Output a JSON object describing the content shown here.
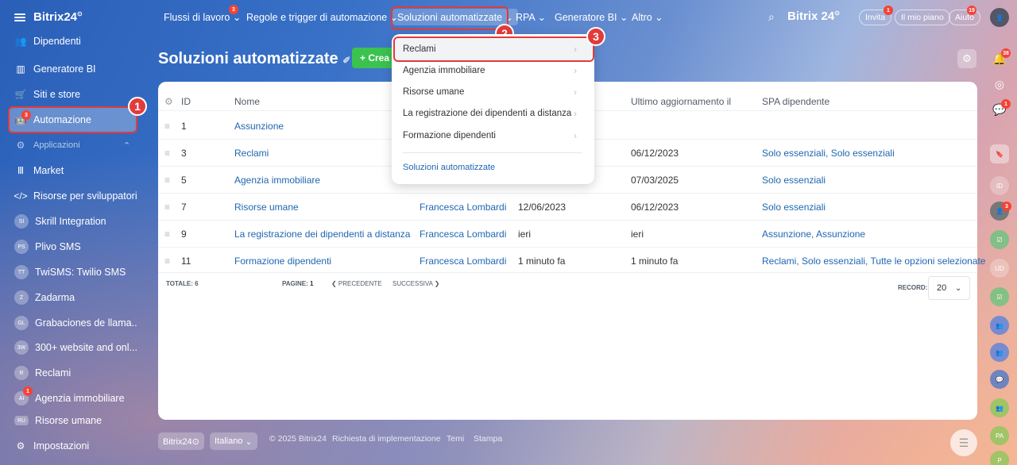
{
  "app": {
    "logo": "Bitrix24",
    "logo_mark": "⊙"
  },
  "sidebar": {
    "items": [
      {
        "label": "Dipendenti",
        "icon": "people-icon"
      },
      {
        "label": "Generatore BI",
        "icon": "chart-icon"
      },
      {
        "label": "Siti e store",
        "icon": "cart-icon"
      },
      {
        "label": "Automazione",
        "icon": "robot-icon",
        "badge": "3"
      },
      {
        "label": "Applicazioni",
        "icon": "apps-icon"
      },
      {
        "label": "Market",
        "icon": "market-icon"
      },
      {
        "label": "Risorse per sviluppatori",
        "icon": "code-icon"
      },
      {
        "label": "Skrill Integration",
        "abbr": "SI"
      },
      {
        "label": "Plivo SMS",
        "abbr": "PS"
      },
      {
        "label": "TwiSMS: Twilio SMS",
        "abbr": "TT"
      },
      {
        "label": "Zadarma",
        "abbr": "Z"
      },
      {
        "label": "Grabaciones de llama...",
        "abbr": "GL"
      },
      {
        "label": "300+ website and onl...",
        "abbr": "3W"
      },
      {
        "label": "Reclami",
        "abbr": "R"
      },
      {
        "label": "Agenzia immobiliare",
        "abbr": "AI",
        "badge": "1"
      },
      {
        "label": "Risorse umane",
        "abbr": "RU"
      }
    ],
    "settings": "Impostazioni"
  },
  "topnav": {
    "items": [
      {
        "label": "Flussi di lavoro",
        "badge": "3"
      },
      {
        "label": "Regole e trigger di automazione"
      },
      {
        "label": "Soluzioni automatizzate"
      },
      {
        "label": "RPA"
      },
      {
        "label": "Generatore BI"
      },
      {
        "label": "Altro"
      }
    ],
    "brand": "Bitrix 24",
    "brand_mark": "⊙",
    "invite": "Invita",
    "invite_badge": "1",
    "plan": "Il mio piano",
    "help": "Aiuto",
    "help_badge": "19"
  },
  "page": {
    "title": "Soluzioni automatizzate",
    "create_label": "+ Crea"
  },
  "table": {
    "headers": [
      "ID",
      "Nome",
      "Ultimo aggiornamento il",
      "SPA dipendente"
    ],
    "rows": [
      {
        "id": "1",
        "name": "Assunzione",
        "author": "",
        "created": "",
        "updated": "",
        "spa": ""
      },
      {
        "id": "3",
        "name": "Reclami",
        "author": "",
        "created": "",
        "updated": "06/12/2023",
        "spa": "Solo essenziali, Solo essenziali"
      },
      {
        "id": "5",
        "name": "Agenzia immobiliare",
        "author": "",
        "created": "",
        "updated": "07/03/2025",
        "spa": "Solo essenziali"
      },
      {
        "id": "7",
        "name": "Risorse umane",
        "author": "Francesca Lombardi",
        "created": "12/06/2023",
        "updated": "06/12/2023",
        "spa": "Solo essenziali"
      },
      {
        "id": "9",
        "name": "La registrazione dei dipendenti a distanza",
        "author": "Francesca Lombardi",
        "created": "ieri",
        "updated": "ieri",
        "spa": "Assunzione, Assunzione"
      },
      {
        "id": "11",
        "name": "Formazione dipendenti",
        "author": "Francesca Lombardi",
        "created": "1 minuto fa",
        "updated": "1 minuto fa",
        "spa": "Reclami, Solo essenziali, Tutte le opzioni selezionate"
      }
    ],
    "total": "TOTALE: 6",
    "pages_label": "PAGINE:",
    "page_num": "1",
    "prev": "❮ PRECEDENTE",
    "next": "SUCCESSIVA ❯",
    "record_label": "RECORD:",
    "record_value": "20"
  },
  "dropdown": {
    "items": [
      "Reclami",
      "Agenzia immobiliare",
      "Risorse umane",
      "La registrazione dei dipendenti a distanza",
      "Formazione dipendenti"
    ],
    "footer_link": "Soluzioni automatizzate"
  },
  "steps": [
    "1",
    "2",
    "3"
  ],
  "footer": {
    "brand": "Bitrix24⊙",
    "language": "Italiano",
    "copyright": "© 2025 Bitrix24",
    "links": [
      "Richiesta di implementazione",
      "Temi",
      "Stampa"
    ]
  },
  "rail": {
    "notif_badge": "38",
    "chat_badge": "1",
    "avatar_badge": "3",
    "rail_abbrs": [
      "ID",
      "UD",
      "PA",
      "P"
    ]
  },
  "colors": {
    "accent_green": "#3bc24f",
    "link_blue": "#2067b0",
    "highlight_red": "#e23b3b"
  }
}
